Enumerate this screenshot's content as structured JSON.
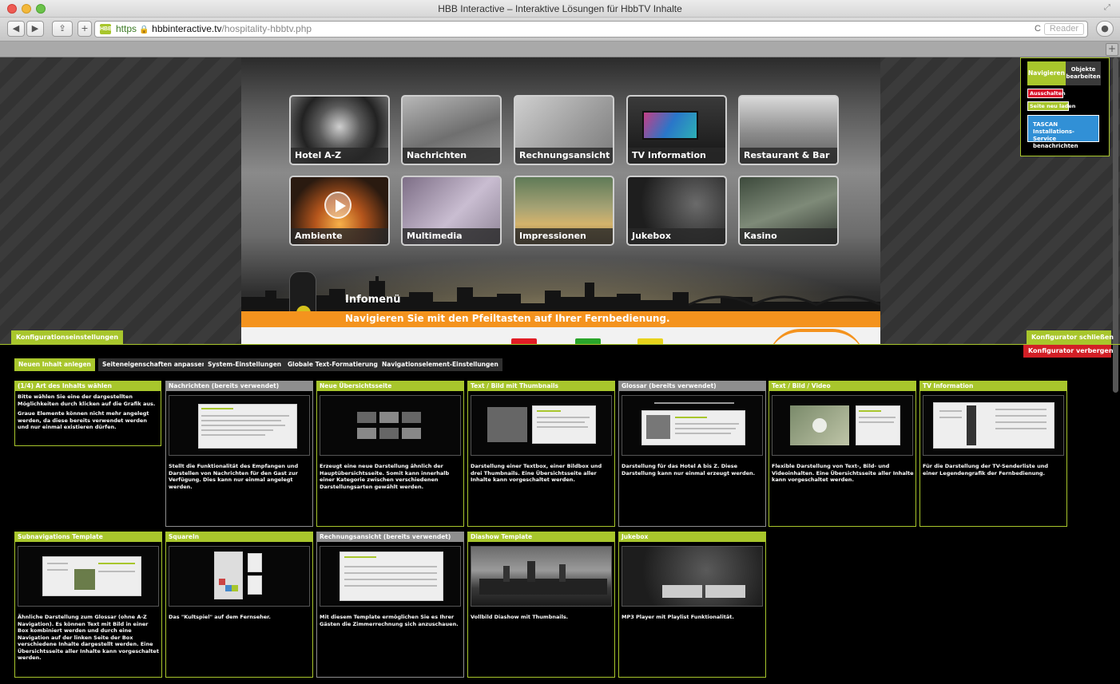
{
  "window": {
    "title": "HBB Interactive – Interaktive Lösungen für HbbTV Inhalte"
  },
  "browser": {
    "url_scheme": "https",
    "url_host": "hbbinteractive.tv",
    "url_path": "/hospitality-hbbtv.php",
    "reload_icon": "C",
    "reader_label": "Reader",
    "favicon_text": "HBB"
  },
  "tv": {
    "tiles": [
      {
        "label": "Hotel A-Z"
      },
      {
        "label": "Nachrichten"
      },
      {
        "label": "Rechnungsansicht"
      },
      {
        "label": "TV Information"
      },
      {
        "label": "Restaurant & Bar"
      },
      {
        "label": "Ambiente"
      },
      {
        "label": "Multimedia"
      },
      {
        "label": "Impressionen"
      },
      {
        "label": "Jukebox"
      },
      {
        "label": "Kasino"
      }
    ],
    "info_title": "Infomenü",
    "info_sub": "Navigieren Sie mit den Pfeiltasten auf Ihrer Fernbedienung."
  },
  "panel": {
    "tab_navigate": "Navigieren",
    "tab_objects": "Objekte bearbeiten",
    "btn_off": "Ausschalten",
    "btn_reload": "Seite neu laden",
    "btn_tascan": "TASCAN Installations-Service benachrichten"
  },
  "config": {
    "settings_label": "Konfigurationseinstellungen",
    "close_label": "Konfigurator schließen",
    "hide_label": "Konfigurator verbergen"
  },
  "tabs": [
    {
      "label": "Neuen Inhalt anlegen",
      "active": true
    },
    {
      "label": "Seiteneigenschaften anpassen",
      "active": false
    },
    {
      "label": "System-Einstellungen",
      "active": false
    },
    {
      "label": "Globale Text-Formatierung",
      "active": false
    },
    {
      "label": "Navigationselement-Einstellungen",
      "active": false
    }
  ],
  "step": {
    "title": "(1/4) Art des Inhalts wählen",
    "line1": "Bitte wählen Sie eine der dargestellten Möglichkeiten durch klicken auf die Grafik aus.",
    "line2": "Graue Elemente können nicht mehr angelegt werden, da diese bereits verwendet werden und nur einmal existieren dürfen."
  },
  "cards": [
    {
      "title": "Nachrichten (bereits verwendet)",
      "desc": "Stellt die Funktionalität des Empfangen und Darstellen von Nachrichten für den Gast zur Verfügung. Dies kann nur einmal angelegt werden.",
      "used": true
    },
    {
      "title": "Neue Übersichtsseite",
      "desc": "Erzeugt eine neue Darstellung ähnlich der Hauptübersichtsseite. Somit kann innerhalb einer Kategorie zwischen verschiedenen Darstellungsarten gewählt werden.",
      "used": false
    },
    {
      "title": "Text / Bild mit Thumbnails",
      "desc": "Darstellung einer Textbox, einer Bildbox und drei Thumbnails. Eine Übersichtsseite aller Inhalte kann vorgeschaltet werden.",
      "used": false
    },
    {
      "title": "Glossar (bereits verwendet)",
      "desc": "Darstellung für das Hotel A bis Z. Diese Darstellung kann nur einmal erzeugt werden.",
      "used": true
    },
    {
      "title": "Text / Bild / Video",
      "desc": "Flexible Darstellung von Text-, Bild- und Videoinhalten. Eine Übersichtsseite aller Inhalte kann vorgeschaltet werden.",
      "used": false
    },
    {
      "title": "TV Information",
      "desc": "Für die Darstellung der TV-Senderliste und einer Legendengrafik der Fernbedienung.",
      "used": false
    },
    {
      "title": "Subnavigations Template",
      "desc": "Ähnliche Darstellung zum Glossar (ohne A-Z Navigation). Es können Text mit Bild in einer Box kombiniert werden und durch eine Navigation auf der linken Seite der Box verschiedene Inhalte dargestellt werden. Eine Übersichtsseite aller Inhalte kann vorgeschaltet werden.",
      "used": false
    },
    {
      "title": "SquareIn",
      "desc": "Das \"Kultspiel\" auf dem Fernseher.",
      "used": false
    },
    {
      "title": "Rechnungsansicht (bereits verwendet)",
      "desc": "Mit diesem Template ermöglichen Sie es Ihrer Gästen die Zimmerrechnung sich anzuschauen.",
      "used": true
    },
    {
      "title": "Diashow Template",
      "desc": "Vollbild Diashow mit Thumbnails.",
      "used": false
    },
    {
      "title": "Jukebox",
      "desc": "MP3 Player mit Playlist Funktionalität.",
      "used": false
    }
  ],
  "colors": {
    "accent": "#a8c62c",
    "used": "#8e8e8e",
    "danger": "#d31f26",
    "info_blue": "#3190d6",
    "tv_bar": "#f4931e"
  }
}
